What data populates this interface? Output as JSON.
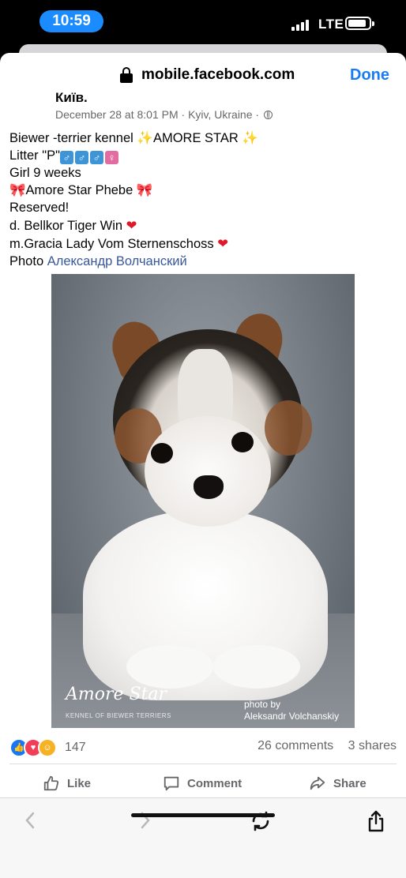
{
  "status": {
    "time": "10:59",
    "network": "LTE"
  },
  "browser": {
    "url": "mobile.facebook.com",
    "done_label": "Done"
  },
  "post": {
    "author": "Київ.",
    "meta": "December 28 at 8:01 PM · Kyiv, Ukraine ·",
    "lines": {
      "l1": "Biewer -terrier kennel ",
      "l1b": "AMORE STAR ",
      "l2": "Litter \"P\"",
      "l3": "Girl 9 weeks",
      "l4": "Amore Star Phebe ",
      "l5": "Reserved!",
      "l6": "d. Bellkor Tiger Win ",
      "l7": "m.Gracia Lady Vom Sternenschoss ",
      "l8": "Photo ",
      "photographer": "Александр Волчанский"
    },
    "photo": {
      "logo": "Amore Star",
      "logo_sub": "KENNEL OF BIEWER TERRIERS",
      "credit_line1": "photo by",
      "credit_line2": "Aleksandr Volchanskiy"
    }
  },
  "engagement": {
    "reaction_count": "147",
    "comments": "26 comments",
    "shares": "3 shares"
  },
  "actions": {
    "like": "Like",
    "comment": "Comment",
    "share": "Share"
  },
  "colors": {
    "accent": "#1a7cf5",
    "link": "#385898",
    "secondary_text": "#65676b"
  }
}
